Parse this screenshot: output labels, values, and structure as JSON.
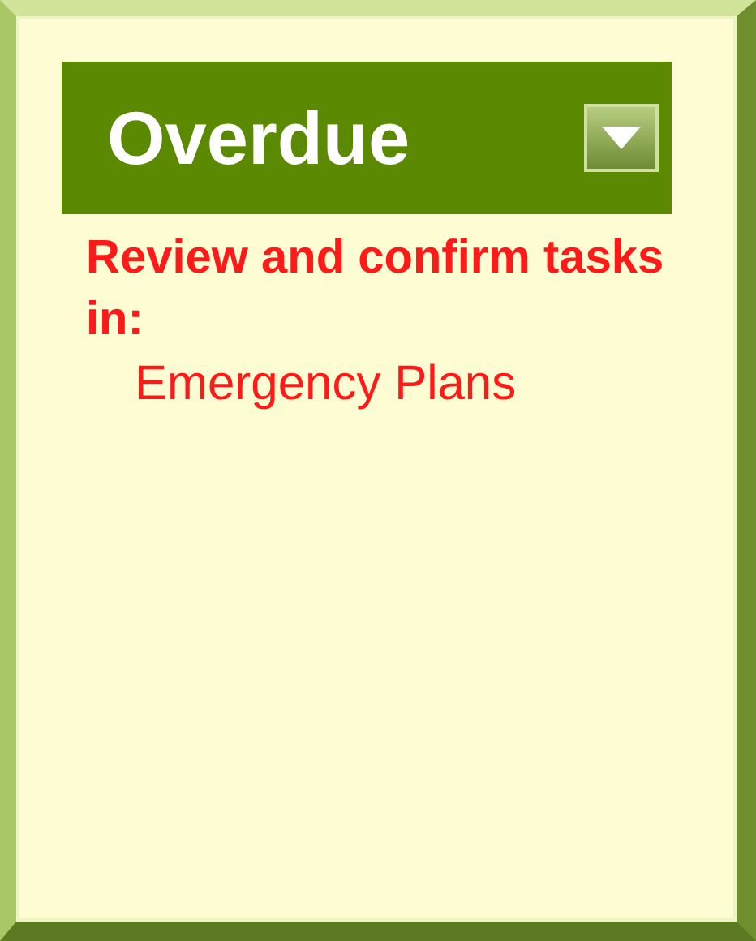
{
  "panel": {
    "title": "Overdue"
  },
  "message": {
    "heading": "Review and confirm tasks in:",
    "items": [
      "Emergency Plans"
    ]
  }
}
